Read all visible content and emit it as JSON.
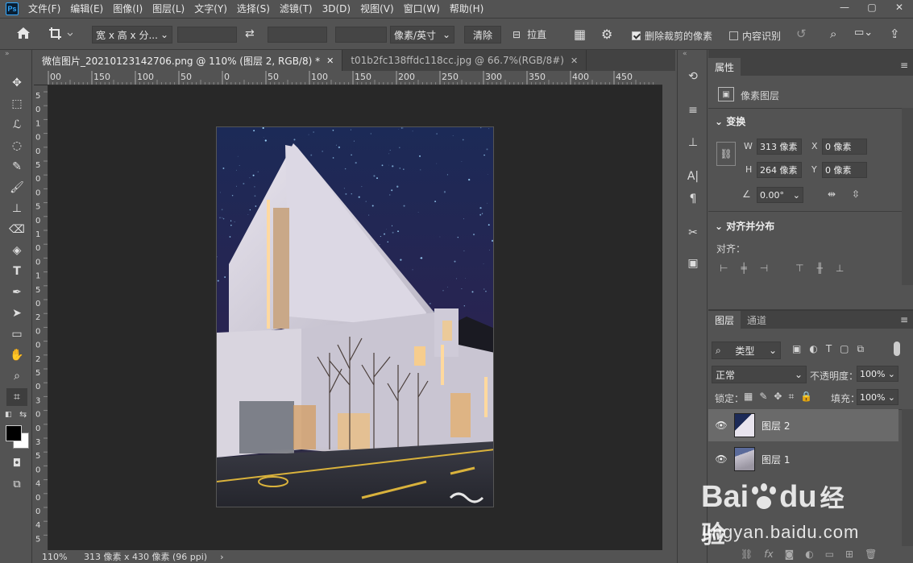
{
  "app": {
    "logo": "Ps"
  },
  "menu": [
    "文件(F)",
    "编辑(E)",
    "图像(I)",
    "图层(L)",
    "文字(Y)",
    "选择(S)",
    "滤镜(T)",
    "3D(D)",
    "视图(V)",
    "窗口(W)",
    "帮助(H)"
  ],
  "window_controls": [
    "—",
    "▢",
    "✕"
  ],
  "options": {
    "ratio_select": "宽 x 高 x 分...",
    "unit_select": "像素/英寸",
    "clear_button": "清除",
    "straighten_label": "拉直",
    "delete_cropped_label": "删除裁剪的像素",
    "content_aware_label": "内容识别"
  },
  "doc_tabs": [
    {
      "label": "微信图片_20210123142706.png @ 110% (图层 2, RGB/8) *",
      "active": true
    },
    {
      "label": "t01b2fc138ffdc118cc.jpg @ 66.7%(RGB/8#)",
      "active": false
    }
  ],
  "ruler_h_labels": [
    "00",
    "150",
    "100",
    "50",
    "0",
    "50",
    "100",
    "150",
    "200",
    "250",
    "300",
    "350",
    "400",
    "450"
  ],
  "ruler_v_labels": [
    "5",
    "0",
    "1",
    "0",
    "0",
    "5",
    "0",
    "0",
    "5",
    "0",
    "1",
    "0",
    "0",
    "1",
    "5",
    "0",
    "2",
    "0",
    "0",
    "2",
    "5",
    "0",
    "3",
    "0",
    "0",
    "3",
    "5",
    "0",
    "4",
    "0",
    "0",
    "4",
    "5"
  ],
  "status": {
    "zoom": "110%",
    "doc_info": "313 像素 x 430 像素 (96 ppi)",
    "arrow": "›"
  },
  "properties": {
    "tab": "属性",
    "layer_type": "像素图层",
    "transform_title": "变换",
    "w_label": "W",
    "w_value": "313 像素",
    "h_label": "H",
    "h_value": "264 像素",
    "x_label": "X",
    "x_value": "0 像素",
    "y_label": "Y",
    "y_value": "0 像素",
    "angle_value": "0.00°",
    "align_title": "对齐并分布",
    "align_label": "对齐："
  },
  "layers_panel": {
    "tabs": [
      "图层",
      "通道"
    ],
    "filter_select": "类型",
    "blend_mode": "正常",
    "opacity_label": "不透明度：",
    "opacity_value": "100%",
    "lock_label": "锁定：",
    "fill_label": "填充：",
    "fill_value": "100%",
    "layers": [
      {
        "name": "图层 2",
        "selected": true
      },
      {
        "name": "图层 1",
        "selected": false
      }
    ]
  },
  "watermark": {
    "brand": "Bai",
    "brand2": "du",
    "cn": "经验",
    "url": "jingyan.baidu.com"
  },
  "colors": {
    "accent": "#31a8ff",
    "bg": "#535353",
    "canvas": "#282828",
    "selected_layer": "#6a6a6a"
  }
}
